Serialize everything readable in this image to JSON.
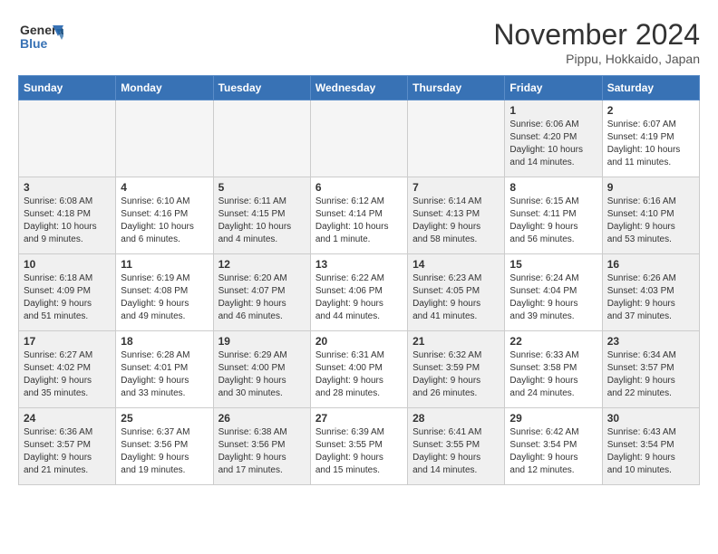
{
  "logo": {
    "line1": "General",
    "line2": "Blue"
  },
  "title": "November 2024",
  "location": "Pippu, Hokkaido, Japan",
  "weekdays": [
    "Sunday",
    "Monday",
    "Tuesday",
    "Wednesday",
    "Thursday",
    "Friday",
    "Saturday"
  ],
  "weeks": [
    [
      {
        "day": "",
        "info": "",
        "empty": true
      },
      {
        "day": "",
        "info": "",
        "empty": true
      },
      {
        "day": "",
        "info": "",
        "empty": true
      },
      {
        "day": "",
        "info": "",
        "empty": true
      },
      {
        "day": "",
        "info": "",
        "empty": true
      },
      {
        "day": "1",
        "info": "Sunrise: 6:06 AM\nSunset: 4:20 PM\nDaylight: 10 hours\nand 14 minutes.",
        "shaded": true
      },
      {
        "day": "2",
        "info": "Sunrise: 6:07 AM\nSunset: 4:19 PM\nDaylight: 10 hours\nand 11 minutes.",
        "shaded": false
      }
    ],
    [
      {
        "day": "3",
        "info": "Sunrise: 6:08 AM\nSunset: 4:18 PM\nDaylight: 10 hours\nand 9 minutes.",
        "shaded": true
      },
      {
        "day": "4",
        "info": "Sunrise: 6:10 AM\nSunset: 4:16 PM\nDaylight: 10 hours\nand 6 minutes.",
        "shaded": false
      },
      {
        "day": "5",
        "info": "Sunrise: 6:11 AM\nSunset: 4:15 PM\nDaylight: 10 hours\nand 4 minutes.",
        "shaded": true
      },
      {
        "day": "6",
        "info": "Sunrise: 6:12 AM\nSunset: 4:14 PM\nDaylight: 10 hours\nand 1 minute.",
        "shaded": false
      },
      {
        "day": "7",
        "info": "Sunrise: 6:14 AM\nSunset: 4:13 PM\nDaylight: 9 hours\nand 58 minutes.",
        "shaded": true
      },
      {
        "day": "8",
        "info": "Sunrise: 6:15 AM\nSunset: 4:11 PM\nDaylight: 9 hours\nand 56 minutes.",
        "shaded": false
      },
      {
        "day": "9",
        "info": "Sunrise: 6:16 AM\nSunset: 4:10 PM\nDaylight: 9 hours\nand 53 minutes.",
        "shaded": true
      }
    ],
    [
      {
        "day": "10",
        "info": "Sunrise: 6:18 AM\nSunset: 4:09 PM\nDaylight: 9 hours\nand 51 minutes.",
        "shaded": true
      },
      {
        "day": "11",
        "info": "Sunrise: 6:19 AM\nSunset: 4:08 PM\nDaylight: 9 hours\nand 49 minutes.",
        "shaded": false
      },
      {
        "day": "12",
        "info": "Sunrise: 6:20 AM\nSunset: 4:07 PM\nDaylight: 9 hours\nand 46 minutes.",
        "shaded": true
      },
      {
        "day": "13",
        "info": "Sunrise: 6:22 AM\nSunset: 4:06 PM\nDaylight: 9 hours\nand 44 minutes.",
        "shaded": false
      },
      {
        "day": "14",
        "info": "Sunrise: 6:23 AM\nSunset: 4:05 PM\nDaylight: 9 hours\nand 41 minutes.",
        "shaded": true
      },
      {
        "day": "15",
        "info": "Sunrise: 6:24 AM\nSunset: 4:04 PM\nDaylight: 9 hours\nand 39 minutes.",
        "shaded": false
      },
      {
        "day": "16",
        "info": "Sunrise: 6:26 AM\nSunset: 4:03 PM\nDaylight: 9 hours\nand 37 minutes.",
        "shaded": true
      }
    ],
    [
      {
        "day": "17",
        "info": "Sunrise: 6:27 AM\nSunset: 4:02 PM\nDaylight: 9 hours\nand 35 minutes.",
        "shaded": true
      },
      {
        "day": "18",
        "info": "Sunrise: 6:28 AM\nSunset: 4:01 PM\nDaylight: 9 hours\nand 33 minutes.",
        "shaded": false
      },
      {
        "day": "19",
        "info": "Sunrise: 6:29 AM\nSunset: 4:00 PM\nDaylight: 9 hours\nand 30 minutes.",
        "shaded": true
      },
      {
        "day": "20",
        "info": "Sunrise: 6:31 AM\nSunset: 4:00 PM\nDaylight: 9 hours\nand 28 minutes.",
        "shaded": false
      },
      {
        "day": "21",
        "info": "Sunrise: 6:32 AM\nSunset: 3:59 PM\nDaylight: 9 hours\nand 26 minutes.",
        "shaded": true
      },
      {
        "day": "22",
        "info": "Sunrise: 6:33 AM\nSunset: 3:58 PM\nDaylight: 9 hours\nand 24 minutes.",
        "shaded": false
      },
      {
        "day": "23",
        "info": "Sunrise: 6:34 AM\nSunset: 3:57 PM\nDaylight: 9 hours\nand 22 minutes.",
        "shaded": true
      }
    ],
    [
      {
        "day": "24",
        "info": "Sunrise: 6:36 AM\nSunset: 3:57 PM\nDaylight: 9 hours\nand 21 minutes.",
        "shaded": true
      },
      {
        "day": "25",
        "info": "Sunrise: 6:37 AM\nSunset: 3:56 PM\nDaylight: 9 hours\nand 19 minutes.",
        "shaded": false
      },
      {
        "day": "26",
        "info": "Sunrise: 6:38 AM\nSunset: 3:56 PM\nDaylight: 9 hours\nand 17 minutes.",
        "shaded": true
      },
      {
        "day": "27",
        "info": "Sunrise: 6:39 AM\nSunset: 3:55 PM\nDaylight: 9 hours\nand 15 minutes.",
        "shaded": false
      },
      {
        "day": "28",
        "info": "Sunrise: 6:41 AM\nSunset: 3:55 PM\nDaylight: 9 hours\nand 14 minutes.",
        "shaded": true
      },
      {
        "day": "29",
        "info": "Sunrise: 6:42 AM\nSunset: 3:54 PM\nDaylight: 9 hours\nand 12 minutes.",
        "shaded": false
      },
      {
        "day": "30",
        "info": "Sunrise: 6:43 AM\nSunset: 3:54 PM\nDaylight: 9 hours\nand 10 minutes.",
        "shaded": true
      }
    ]
  ]
}
